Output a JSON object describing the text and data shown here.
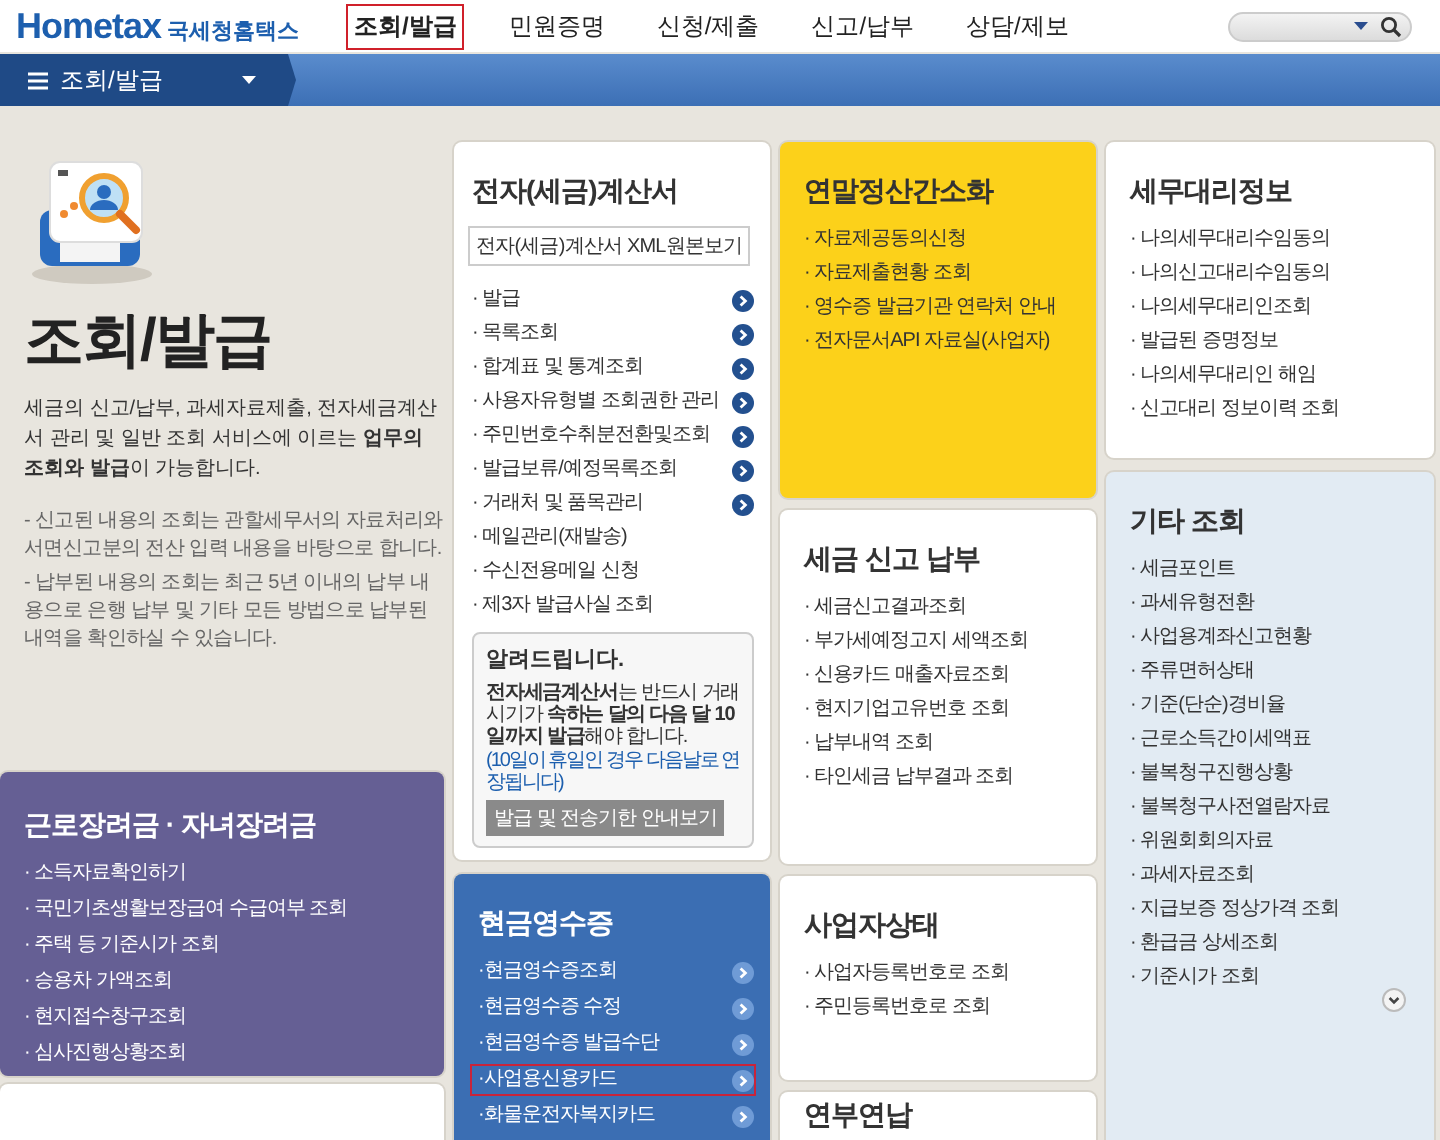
{
  "header": {
    "logo": "Hometax",
    "logo_sub": "국세청홈택스",
    "nav": [
      {
        "label": "조회/발급",
        "selected": true,
        "highlighted": true
      },
      {
        "label": "민원증명",
        "selected": false,
        "highlighted": false
      },
      {
        "label": "신청/제출",
        "selected": false,
        "highlighted": false
      },
      {
        "label": "신고/납부",
        "selected": false,
        "highlighted": false
      },
      {
        "label": "상담/제보",
        "selected": false,
        "highlighted": false
      }
    ]
  },
  "menu_bar": {
    "label": "조회/발급"
  },
  "intro": {
    "title": "조회/발급",
    "description": "세금의 신고/납부, 과세자료제출, 전자세금계산서 관리 및 일반 조회 서비스에 이르는 **업무의 조회와 발급**이 가능합니다.",
    "notes": [
      "- 신고된 내용의 조회는 관할세무서의 자료처리와 서면신고분의 전산 입력 내용을 바탕으로 합니다.",
      "- 납부된 내용의 조회는 최근 5년 이내의 납부 내용으로 은행 납부 및 기타 모든 방법으로 납부된 내역을 확인하실 수 있습니다."
    ]
  },
  "columns": [
    [
      {
        "color": "#655f94",
        "title": "근로장려금 · 자녀장려금",
        "items": [
          {
            "label": "· 소득자료확인하기",
            "arrow": false,
            "highlighted": false
          },
          {
            "label": "· 국민기초생활보장급여 수급여부 조회",
            "arrow": false,
            "highlighted": false
          },
          {
            "label": "· 주택 등 기준시가 조회",
            "arrow": false,
            "highlighted": false
          },
          {
            "label": "· 승용차 가액조회",
            "arrow": false,
            "highlighted": false
          },
          {
            "label": "· 현지접수창구조회",
            "arrow": false,
            "highlighted": false
          },
          {
            "label": "· 심사진행상황조회",
            "arrow": false,
            "highlighted": false
          }
        ]
      },
      {
        "color": "#ffffff"
      }
    ],
    [
      {
        "color": "#ffffff",
        "title": "전자(세금)계산서",
        "button": "전자(세금)계산서 XML원본보기",
        "items": [
          {
            "label": "· 발급",
            "arrow": true,
            "highlighted": false
          },
          {
            "label": "· 목록조회",
            "arrow": true,
            "highlighted": false
          },
          {
            "label": "· 합계표 및 통계조회",
            "arrow": true,
            "highlighted": false
          },
          {
            "label": "· 사용자유형별 조회권한 관리",
            "arrow": true,
            "highlighted": false
          },
          {
            "label": "· 주민번호수취분전환및조회",
            "arrow": true,
            "highlighted": false
          },
          {
            "label": "· 발급보류/예정목록조회",
            "arrow": true,
            "highlighted": false
          },
          {
            "label": "· 거래처 및 품목관리",
            "arrow": true,
            "highlighted": false
          },
          {
            "label": "· 메일관리(재발송)",
            "arrow": false,
            "highlighted": false
          },
          {
            "label": "· 수신전용메일 신청",
            "arrow": false,
            "highlighted": false
          },
          {
            "label": "· 제3자 발급사실 조회",
            "arrow": false,
            "highlighted": false
          }
        ],
        "notice": {
          "title": "알려드립니다.",
          "text": "**전자세금계산서**는 반드시 거래시기가 **속하는 달의 다음 달 10일까지 발급**해야 합니다.",
          "note": "(10일이 휴일인 경우 다음날로 연장됩니다)",
          "button": "발급 및 전송기한 안내보기"
        }
      },
      {
        "color": "#3b6eb3",
        "title": "현금영수증",
        "items": [
          {
            "label": "·현금영수증조회",
            "arrow": true,
            "highlighted": false
          },
          {
            "label": "·현금영수증 수정",
            "arrow": true,
            "highlighted": false
          },
          {
            "label": "·현금영수증 발급수단",
            "arrow": true,
            "highlighted": false
          },
          {
            "label": "·사업용신용카드",
            "arrow": true,
            "highlighted": true
          },
          {
            "label": "·화물운전자복지카드",
            "arrow": true,
            "highlighted": false
          }
        ]
      }
    ],
    [
      {
        "color": "#fcd11a",
        "title": "연말정산간소화",
        "items": [
          {
            "label": "· 자료제공동의신청",
            "arrow": false,
            "highlighted": false
          },
          {
            "label": "· 자료제출현황 조회",
            "arrow": false,
            "highlighted": false
          },
          {
            "label": "· 영수증 발급기관 연락처 안내",
            "arrow": false,
            "highlighted": false
          },
          {
            "label": "· 전자문서API 자료실(사업자)",
            "arrow": false,
            "highlighted": false
          }
        ]
      },
      {
        "color": "#ffffff",
        "title": "세금 신고 납부",
        "items": [
          {
            "label": "· 세금신고결과조회",
            "arrow": false,
            "highlighted": false
          },
          {
            "label": "· 부가세예정고지 세액조회",
            "arrow": false,
            "highlighted": false
          },
          {
            "label": "· 신용카드 매출자료조회",
            "arrow": false,
            "highlighted": false
          },
          {
            "label": "· 현지기업고유번호 조회",
            "arrow": false,
            "highlighted": false
          },
          {
            "label": "· 납부내역 조회",
            "arrow": false,
            "highlighted": false
          },
          {
            "label": "· 타인세금 납부결과 조회",
            "arrow": false,
            "highlighted": false
          }
        ]
      },
      {
        "color": "#ffffff",
        "title": "사업자상태",
        "items": [
          {
            "label": "· 사업자등록번호로 조회",
            "arrow": false,
            "highlighted": false
          },
          {
            "label": "· 주민등록번호로 조회",
            "arrow": false,
            "highlighted": false
          }
        ]
      },
      {
        "color": "#ffffff",
        "title": "연부연납"
      }
    ],
    [
      {
        "color": "#ffffff",
        "title": "세무대리정보",
        "items": [
          {
            "label": "· 나의세무대리수임동의",
            "arrow": false,
            "highlighted": false
          },
          {
            "label": "· 나의신고대리수임동의",
            "arrow": false,
            "highlighted": false
          },
          {
            "label": "· 나의세무대리인조회",
            "arrow": false,
            "highlighted": false
          },
          {
            "label": "· 발급된 증명정보",
            "arrow": false,
            "highlighted": false
          },
          {
            "label": "· 나의세무대리인 해임",
            "arrow": false,
            "highlighted": false
          },
          {
            "label": "· 신고대리 정보이력 조회",
            "arrow": false,
            "highlighted": false
          }
        ]
      },
      {
        "color": "#e2ebf3",
        "title": "기타 조회",
        "expandable": true,
        "items": [
          {
            "label": "· 세금포인트",
            "arrow": false,
            "highlighted": false
          },
          {
            "label": "· 과세유형전환",
            "arrow": false,
            "highlighted": false
          },
          {
            "label": "· 사업용계좌신고현황",
            "arrow": false,
            "highlighted": false
          },
          {
            "label": "· 주류면허상태",
            "arrow": false,
            "highlighted": false
          },
          {
            "label": "· 기준(단순)경비율",
            "arrow": false,
            "highlighted": false
          },
          {
            "label": "· 근로소득간이세액표",
            "arrow": false,
            "highlighted": false
          },
          {
            "label": "· 불복청구진행상황",
            "arrow": false,
            "highlighted": false
          },
          {
            "label": "· 불복청구사전열람자료",
            "arrow": false,
            "highlighted": false
          },
          {
            "label": "· 위원회회의자료",
            "arrow": false,
            "highlighted": false
          },
          {
            "label": "· 과세자료조회",
            "arrow": false,
            "highlighted": false
          },
          {
            "label": "· 지급보증 정상가격 조회",
            "arrow": false,
            "highlighted": false
          },
          {
            "label": "· 환급금 상세조회",
            "arrow": false,
            "highlighted": false
          },
          {
            "label": "· 기준시가 조회",
            "arrow": false,
            "highlighted": false
          }
        ]
      }
    ]
  ]
}
